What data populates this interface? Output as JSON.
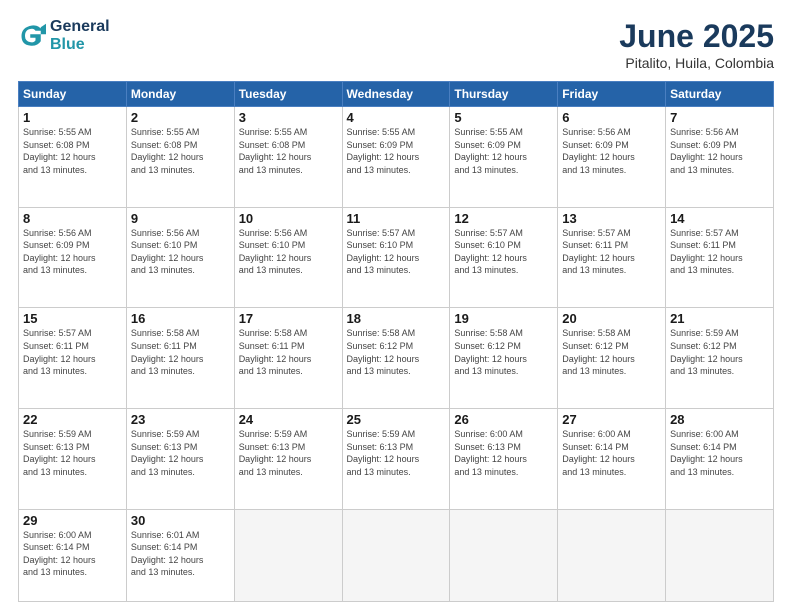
{
  "logo": {
    "line1": "General",
    "line2": "Blue"
  },
  "title": "June 2025",
  "location": "Pitalito, Huila, Colombia",
  "days_of_week": [
    "Sunday",
    "Monday",
    "Tuesday",
    "Wednesday",
    "Thursday",
    "Friday",
    "Saturday"
  ],
  "weeks": [
    [
      {
        "day": 1,
        "sunrise": "5:55 AM",
        "sunset": "6:08 PM",
        "daylight": "12 hours and 13 minutes."
      },
      {
        "day": 2,
        "sunrise": "5:55 AM",
        "sunset": "6:08 PM",
        "daylight": "12 hours and 13 minutes."
      },
      {
        "day": 3,
        "sunrise": "5:55 AM",
        "sunset": "6:08 PM",
        "daylight": "12 hours and 13 minutes."
      },
      {
        "day": 4,
        "sunrise": "5:55 AM",
        "sunset": "6:09 PM",
        "daylight": "12 hours and 13 minutes."
      },
      {
        "day": 5,
        "sunrise": "5:55 AM",
        "sunset": "6:09 PM",
        "daylight": "12 hours and 13 minutes."
      },
      {
        "day": 6,
        "sunrise": "5:56 AM",
        "sunset": "6:09 PM",
        "daylight": "12 hours and 13 minutes."
      },
      {
        "day": 7,
        "sunrise": "5:56 AM",
        "sunset": "6:09 PM",
        "daylight": "12 hours and 13 minutes."
      }
    ],
    [
      {
        "day": 8,
        "sunrise": "5:56 AM",
        "sunset": "6:09 PM",
        "daylight": "12 hours and 13 minutes."
      },
      {
        "day": 9,
        "sunrise": "5:56 AM",
        "sunset": "6:10 PM",
        "daylight": "12 hours and 13 minutes."
      },
      {
        "day": 10,
        "sunrise": "5:56 AM",
        "sunset": "6:10 PM",
        "daylight": "12 hours and 13 minutes."
      },
      {
        "day": 11,
        "sunrise": "5:57 AM",
        "sunset": "6:10 PM",
        "daylight": "12 hours and 13 minutes."
      },
      {
        "day": 12,
        "sunrise": "5:57 AM",
        "sunset": "6:10 PM",
        "daylight": "12 hours and 13 minutes."
      },
      {
        "day": 13,
        "sunrise": "5:57 AM",
        "sunset": "6:11 PM",
        "daylight": "12 hours and 13 minutes."
      },
      {
        "day": 14,
        "sunrise": "5:57 AM",
        "sunset": "6:11 PM",
        "daylight": "12 hours and 13 minutes."
      }
    ],
    [
      {
        "day": 15,
        "sunrise": "5:57 AM",
        "sunset": "6:11 PM",
        "daylight": "12 hours and 13 minutes."
      },
      {
        "day": 16,
        "sunrise": "5:58 AM",
        "sunset": "6:11 PM",
        "daylight": "12 hours and 13 minutes."
      },
      {
        "day": 17,
        "sunrise": "5:58 AM",
        "sunset": "6:11 PM",
        "daylight": "12 hours and 13 minutes."
      },
      {
        "day": 18,
        "sunrise": "5:58 AM",
        "sunset": "6:12 PM",
        "daylight": "12 hours and 13 minutes."
      },
      {
        "day": 19,
        "sunrise": "5:58 AM",
        "sunset": "6:12 PM",
        "daylight": "12 hours and 13 minutes."
      },
      {
        "day": 20,
        "sunrise": "5:58 AM",
        "sunset": "6:12 PM",
        "daylight": "12 hours and 13 minutes."
      },
      {
        "day": 21,
        "sunrise": "5:59 AM",
        "sunset": "6:12 PM",
        "daylight": "12 hours and 13 minutes."
      }
    ],
    [
      {
        "day": 22,
        "sunrise": "5:59 AM",
        "sunset": "6:13 PM",
        "daylight": "12 hours and 13 minutes."
      },
      {
        "day": 23,
        "sunrise": "5:59 AM",
        "sunset": "6:13 PM",
        "daylight": "12 hours and 13 minutes."
      },
      {
        "day": 24,
        "sunrise": "5:59 AM",
        "sunset": "6:13 PM",
        "daylight": "12 hours and 13 minutes."
      },
      {
        "day": 25,
        "sunrise": "5:59 AM",
        "sunset": "6:13 PM",
        "daylight": "12 hours and 13 minutes."
      },
      {
        "day": 26,
        "sunrise": "6:00 AM",
        "sunset": "6:13 PM",
        "daylight": "12 hours and 13 minutes."
      },
      {
        "day": 27,
        "sunrise": "6:00 AM",
        "sunset": "6:14 PM",
        "daylight": "12 hours and 13 minutes."
      },
      {
        "day": 28,
        "sunrise": "6:00 AM",
        "sunset": "6:14 PM",
        "daylight": "12 hours and 13 minutes."
      }
    ],
    [
      {
        "day": 29,
        "sunrise": "6:00 AM",
        "sunset": "6:14 PM",
        "daylight": "12 hours and 13 minutes."
      },
      {
        "day": 30,
        "sunrise": "6:01 AM",
        "sunset": "6:14 PM",
        "daylight": "12 hours and 13 minutes."
      },
      null,
      null,
      null,
      null,
      null
    ]
  ]
}
